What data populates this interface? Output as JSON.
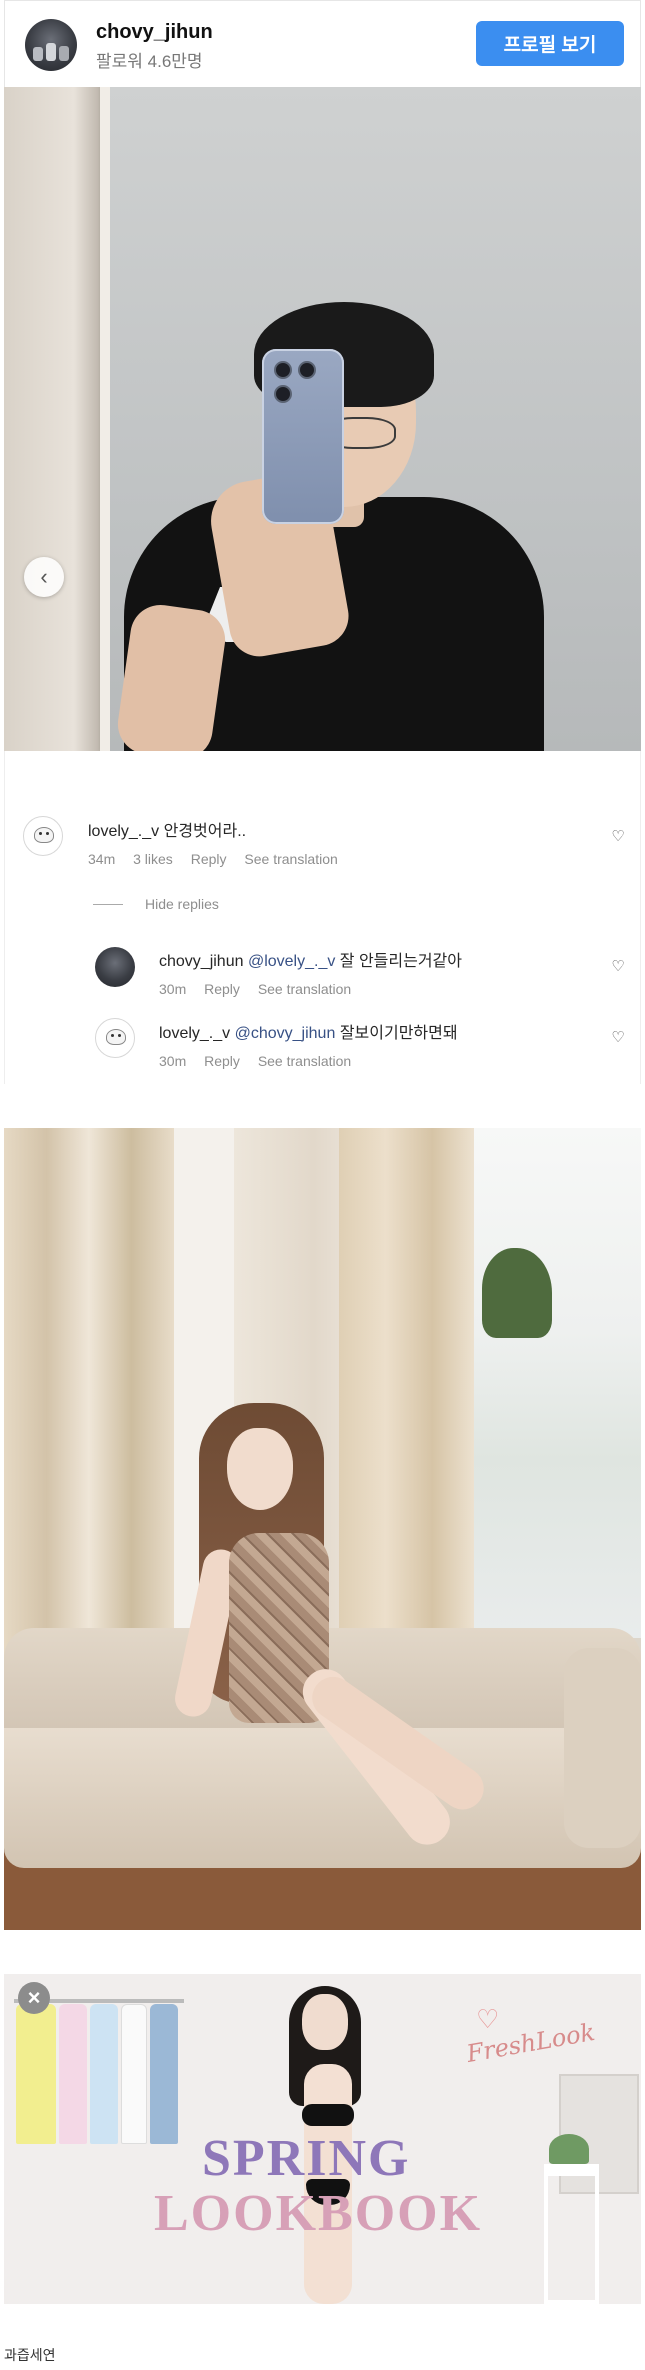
{
  "profile": {
    "username": "chovy_jihun",
    "followers": "팔로워 4.6만명",
    "view_profile_button": "프로필 보기"
  },
  "post": {
    "prev_icon": "chevron-left-icon",
    "prev_glyph": "‹"
  },
  "comments": {
    "main": {
      "username": "lovely_._v",
      "text": "안경벗어라..",
      "time": "34m",
      "likes": "3 likes",
      "reply": "Reply",
      "translate": "See translation"
    },
    "hide_replies": "Hide replies",
    "replies": [
      {
        "username": "chovy_jihun",
        "mention": "@lovely_._v",
        "text": "잘 안들리는거같아",
        "time": "30m",
        "reply": "Reply",
        "translate": "See translation"
      },
      {
        "username": "lovely_._v",
        "mention": "@chovy_jihun",
        "text": "잘보이기만하면돼",
        "time": "30m",
        "reply": "Reply",
        "translate": "See translation"
      }
    ],
    "heart_glyph": "♡"
  },
  "ad2": {
    "close_glyph": "×",
    "brand": "FreshLook",
    "heart_glyph": "♡",
    "line1": "SPRING",
    "line2": "LOOKBOOK"
  },
  "footer": {
    "text": "과즙세연"
  }
}
